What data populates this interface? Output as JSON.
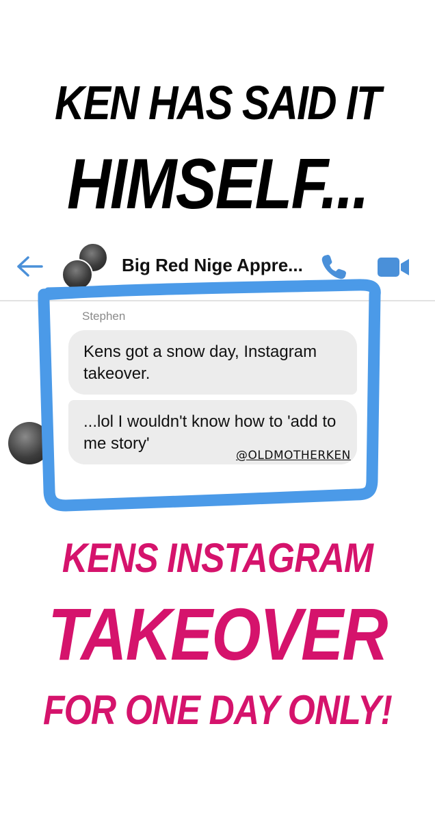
{
  "headline": {
    "line1": "KEN HAS SAID IT",
    "line2": "HIMSELF..."
  },
  "chat": {
    "title": "Big Red Nige Appre...",
    "sender": "Stephen",
    "messages": [
      "Kens got a snow day, Instagram takeover.",
      "...lol I wouldn't know how to 'add to me story'"
    ],
    "mention": "@OLDMOTHERKEN",
    "icons": {
      "back": "back-arrow-icon",
      "phone": "phone-icon",
      "video": "video-camera-icon"
    }
  },
  "promo": {
    "line1": "KENS INSTAGRAM",
    "line2": "TAKEOVER",
    "line3": "FOR ONE DAY ONLY!"
  },
  "colors": {
    "accent_blue": "#4a90d9",
    "highlight_blue": "#4b9ae8",
    "promo_pink": "#d5136c",
    "bubble_gray": "#ececec"
  }
}
